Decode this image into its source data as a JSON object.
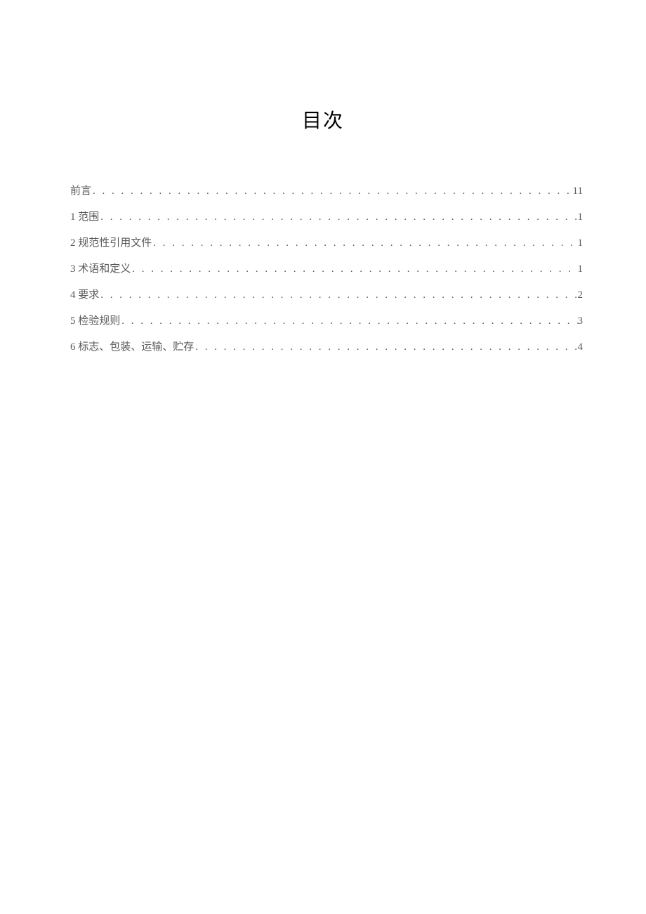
{
  "title": "目次",
  "toc": {
    "entries": [
      {
        "label": "前言",
        "page": "11"
      },
      {
        "label": "1 范围",
        "page": "1"
      },
      {
        "label": "2 规范性引用文件",
        "page": "1"
      },
      {
        "label": "3 术语和定义",
        "page": "1"
      },
      {
        "label": "4 要求",
        "page": "2"
      },
      {
        "label": "5 检验规则",
        "page": "3"
      },
      {
        "label": "6 标志、包装、运输、贮存",
        "page": "4"
      }
    ]
  },
  "dot_fill": ". . . . . . . . . . . . . . . . . . . . . . . . . . . . . . . . . . . . . . . . . . . . . . . . . . . . . . . . . . . . . . . . . . . . . . . . . . . . . . . . . . . . . . . . . . . . . . . . . . . . . . . . . . . . . . . . . . . . . . . . . . . . . . . . . . . . . . . . . . . . . . . . . . . . . . . . . . . . . . . . . . . . . . . . . . . . . . . . . . . ."
}
